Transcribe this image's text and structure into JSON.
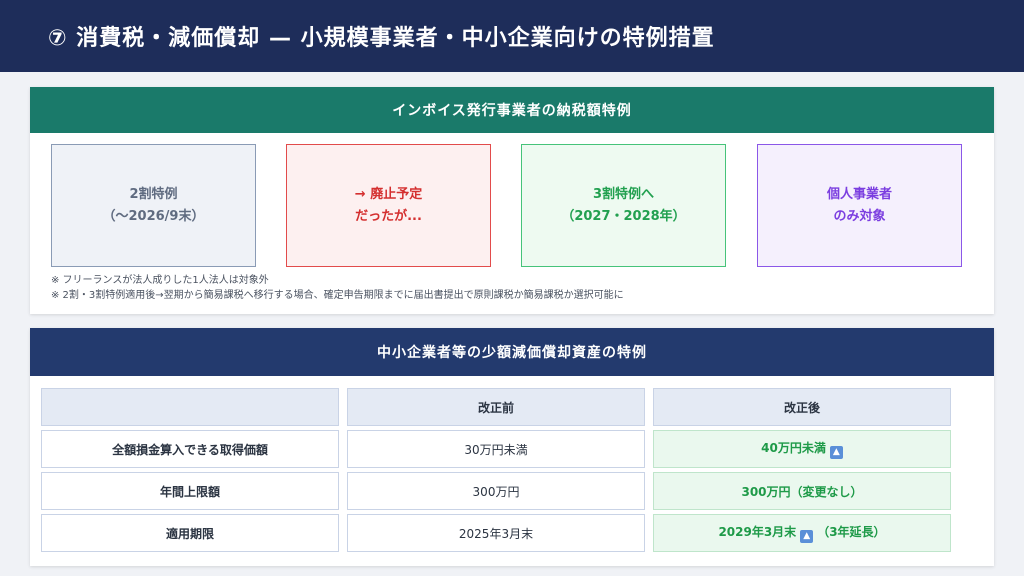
{
  "header": {
    "title": "⑦ 消費税・減価償却 — 小規模事業者・中小企業向けの特例措置"
  },
  "invoice": {
    "title": "インボイス発行事業者の納税額特例",
    "boxes": [
      {
        "line1": "2割特例",
        "line2": "（〜2026/9末）"
      },
      {
        "line1": "→ 廃止予定",
        "line2": "だったが..."
      },
      {
        "line1": "3割特例へ",
        "line2": "（2027・2028年）"
      },
      {
        "line1": "個人事業者",
        "line2": "のみ対象"
      }
    ],
    "notes": [
      "※ フリーランスが法人成りした1人法人は対象外",
      "※ 2割・3割特例適用後→翌期から簡易課税へ移行する場合、確定申告期限までに届出書提出で原則課税か簡易課税か選択可能に"
    ]
  },
  "depreciation": {
    "title": "中小企業者等の少額減価償却資産の特例",
    "headers": [
      "",
      "改正前",
      "改正後"
    ],
    "rows": [
      {
        "label": "全額損金算入できる取得価額",
        "before": "30万円未満",
        "after": "40万円未満",
        "after_note": ""
      },
      {
        "label": "年間上限額",
        "before": "300万円",
        "after": "300万円（変更なし）",
        "after_note": ""
      },
      {
        "label": "適用期限",
        "before": "2025年3月末",
        "after": "2029年3月末",
        "after_note": "（3年延長）"
      }
    ],
    "up_icon": "up-arrow-icon"
  },
  "colors": {
    "header_bg": "#1e2d5a",
    "teal": "#1a7a6a",
    "navy": "#233a6e",
    "gray": "#5f6b80",
    "red": "#d42f2f",
    "green": "#22a050",
    "purple": "#7b3ee0",
    "up_icon": "#5a8fd8"
  }
}
